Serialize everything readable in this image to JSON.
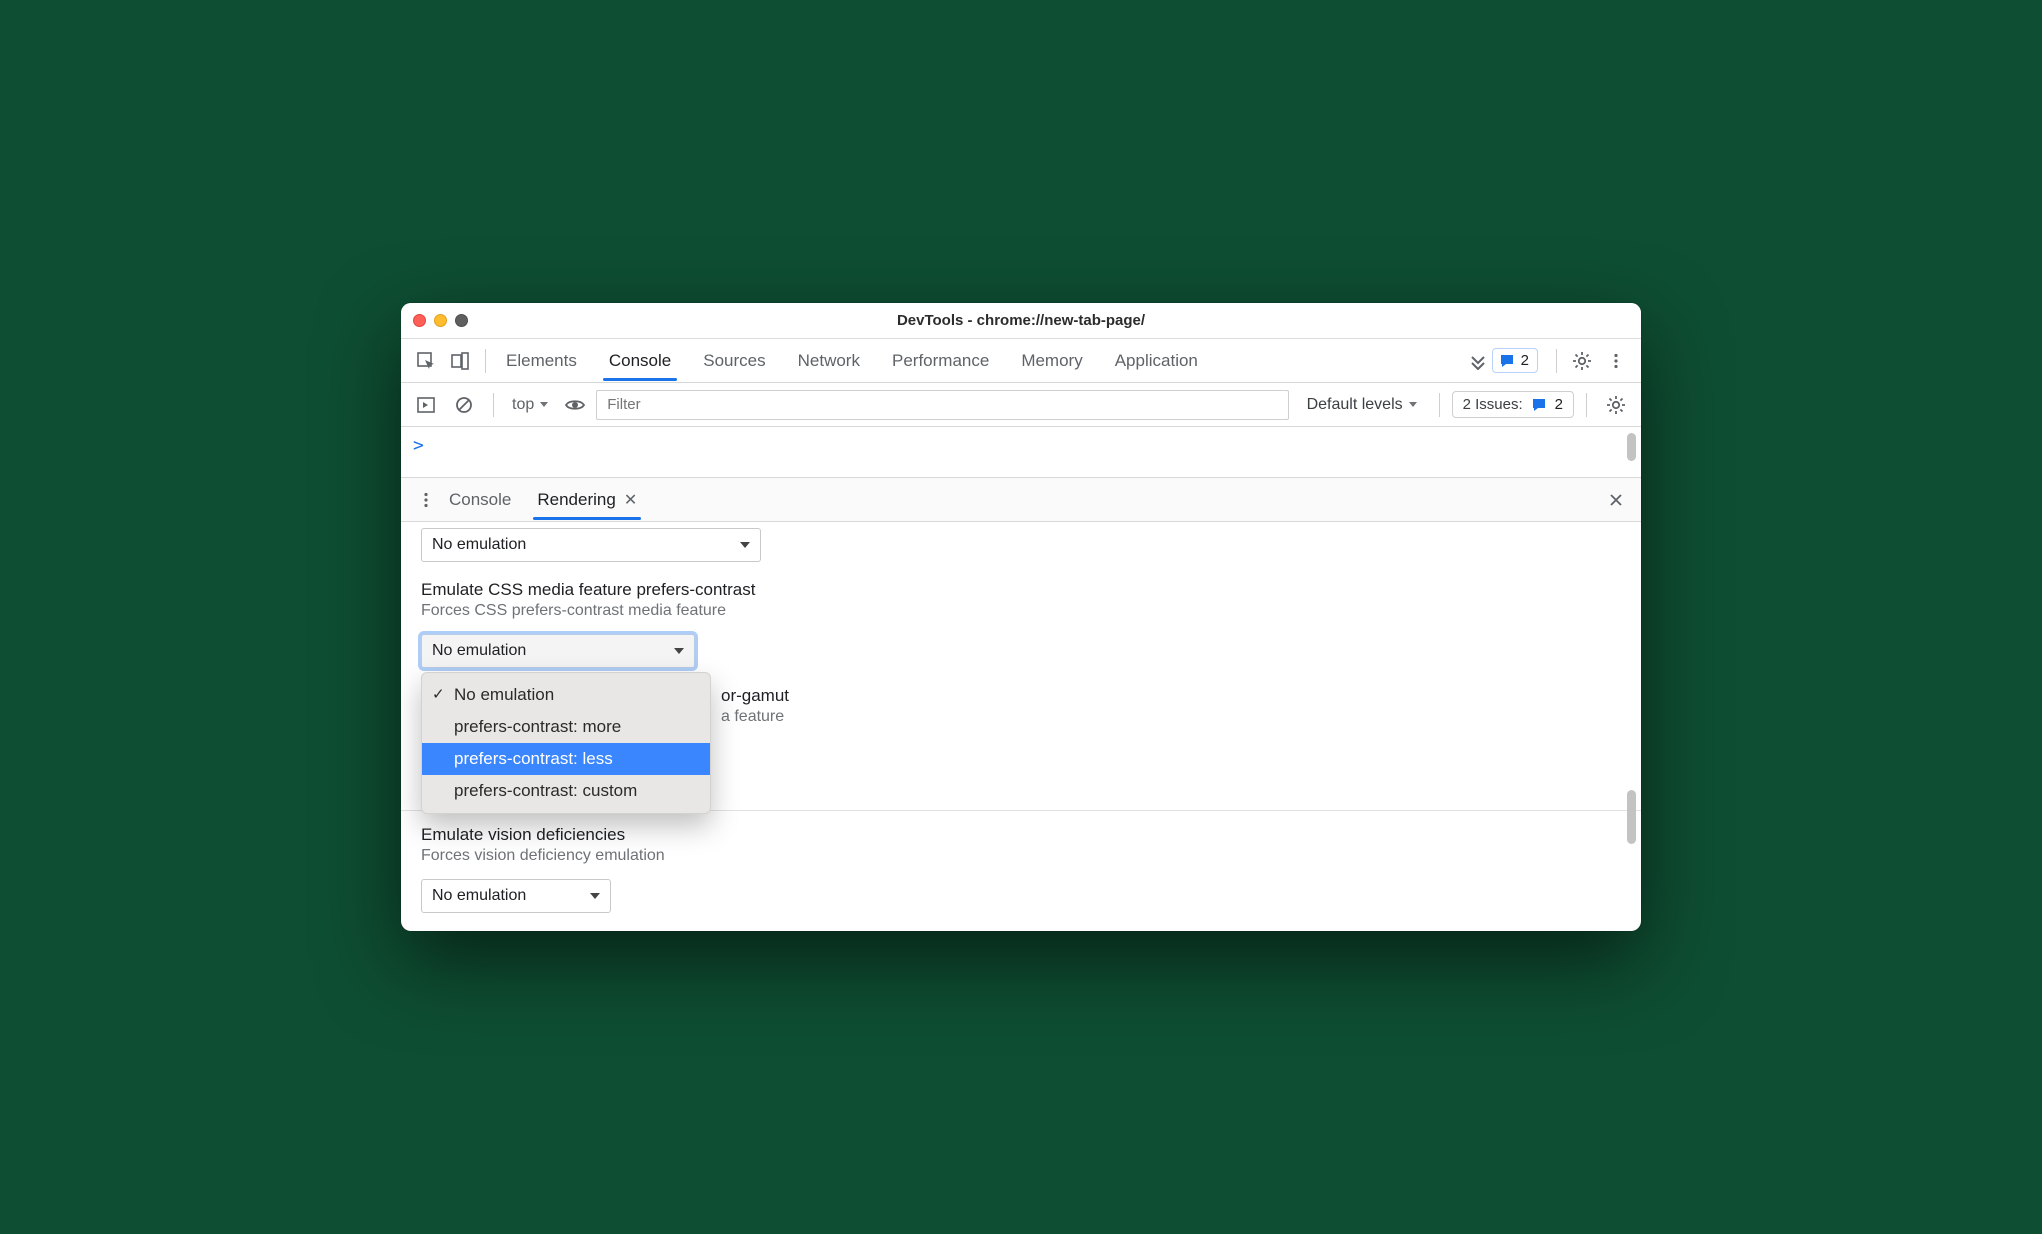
{
  "window": {
    "title": "DevTools - chrome://new-tab-page/"
  },
  "mainTabs": {
    "items": [
      "Elements",
      "Console",
      "Sources",
      "Network",
      "Performance",
      "Memory",
      "Application"
    ],
    "active": "Console"
  },
  "mainBadge": {
    "count": "2"
  },
  "subtool": {
    "context": "top",
    "filterPlaceholder": "Filter",
    "levels": "Default levels",
    "issuesLabel": "2 Issues:",
    "issuesCount": "2"
  },
  "console": {
    "prompt": ">"
  },
  "drawer": {
    "tabs": {
      "console": "Console",
      "rendering": "Rendering"
    }
  },
  "rendering": {
    "prevSelectValue": "No emulation",
    "contrast": {
      "title": "Emulate CSS media feature prefers-contrast",
      "desc": "Forces CSS prefers-contrast media feature",
      "selectValue": "No emulation",
      "options": [
        {
          "label": "No emulation",
          "checked": true,
          "highlighted": false
        },
        {
          "label": "prefers-contrast: more",
          "checked": false,
          "highlighted": false
        },
        {
          "label": "prefers-contrast: less",
          "checked": false,
          "highlighted": true
        },
        {
          "label": "prefers-contrast: custom",
          "checked": false,
          "highlighted": false
        }
      ]
    },
    "colorGamut": {
      "titleTail": "or-gamut",
      "descTail": "a feature"
    },
    "vision": {
      "title": "Emulate vision deficiencies",
      "desc": "Forces vision deficiency emulation",
      "selectValue": "No emulation"
    }
  }
}
